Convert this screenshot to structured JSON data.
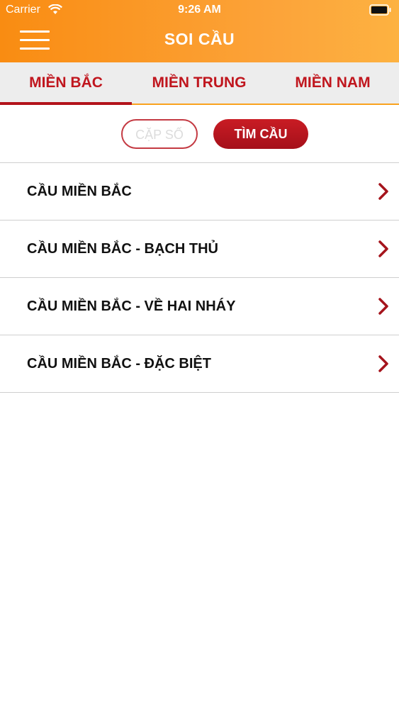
{
  "status_bar": {
    "carrier": "Carrier",
    "time": "9:26 AM"
  },
  "header": {
    "title": "SOI CẦU",
    "menu_icon": "hamburger-menu-icon"
  },
  "tabs": [
    {
      "label": "MIỀN BẮC",
      "active": true
    },
    {
      "label": "MIỀN TRUNG",
      "active": false
    },
    {
      "label": "MIỀN NAM",
      "active": false
    }
  ],
  "filters": {
    "pair_label": "CẶP SỐ",
    "search_label": "TÌM CẦU"
  },
  "list": [
    {
      "label": "CẦU MIỀN BẮC"
    },
    {
      "label": "CẦU MIỀN BẮC - BẠCH THỦ"
    },
    {
      "label": "CẦU MIỀN BẮC - VỀ HAI NHÁY"
    },
    {
      "label": "CẦU MIỀN BẮC - ĐẶC BIỆT"
    }
  ],
  "colors": {
    "header_gradient_start": "#f98c12",
    "header_gradient_end": "#fdb241",
    "accent_red": "#c0161e",
    "tab_underline": "#f9a21e"
  }
}
